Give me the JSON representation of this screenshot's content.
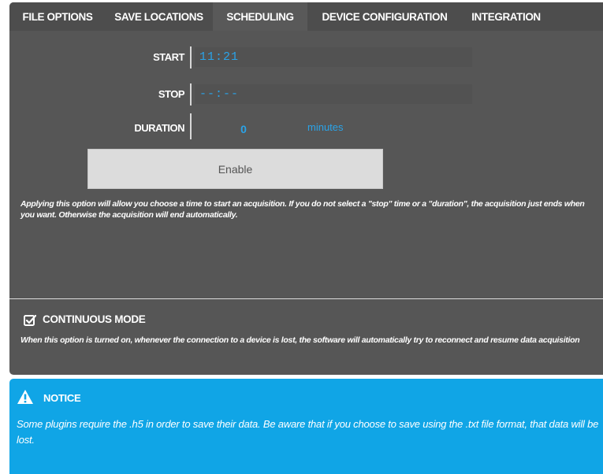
{
  "tabs": [
    {
      "label": "FILE OPTIONS"
    },
    {
      "label": "SAVE LOCATIONS"
    },
    {
      "label": "SCHEDULING"
    },
    {
      "label": "DEVICE CONFIGURATION"
    },
    {
      "label": "INTEGRATION"
    }
  ],
  "active_tab": "SCHEDULING",
  "schedule": {
    "start_label": "START",
    "start_value": "11:21",
    "stop_label": "STOP",
    "stop_placeholder": "--:--",
    "duration_label": "DURATION",
    "duration_value": "0",
    "duration_unit": "minutes",
    "enable_label": "Enable",
    "description": "Applying this option will allow you choose a time to start an acquisition. If you do not select a \"stop\" time or a \"duration\", the acquisition just ends when you want. Otherwise the acquisition will end automatically."
  },
  "continuous": {
    "title": "CONTINUOUS MODE",
    "checked": true,
    "description": "When this option is turned on, whenever the connection to a device is lost, the software will automatically try to reconnect and resume data acquisition"
  },
  "notice": {
    "title": "NOTICE",
    "text": "Some plugins require the .h5 in order to save their data. Be aware that if you choose to save using the .txt file format, that data will be lost."
  },
  "colors": {
    "panel_bg": "#565656",
    "tab_bar_bg": "#4d4d4d",
    "accent_blue": "#2aa3e8",
    "notice_bg": "#10a5e6",
    "button_bg": "#dcdcdc"
  },
  "icons": {
    "checkbox": "checkbox-checked-icon",
    "notice": "warning-triangle-icon"
  }
}
